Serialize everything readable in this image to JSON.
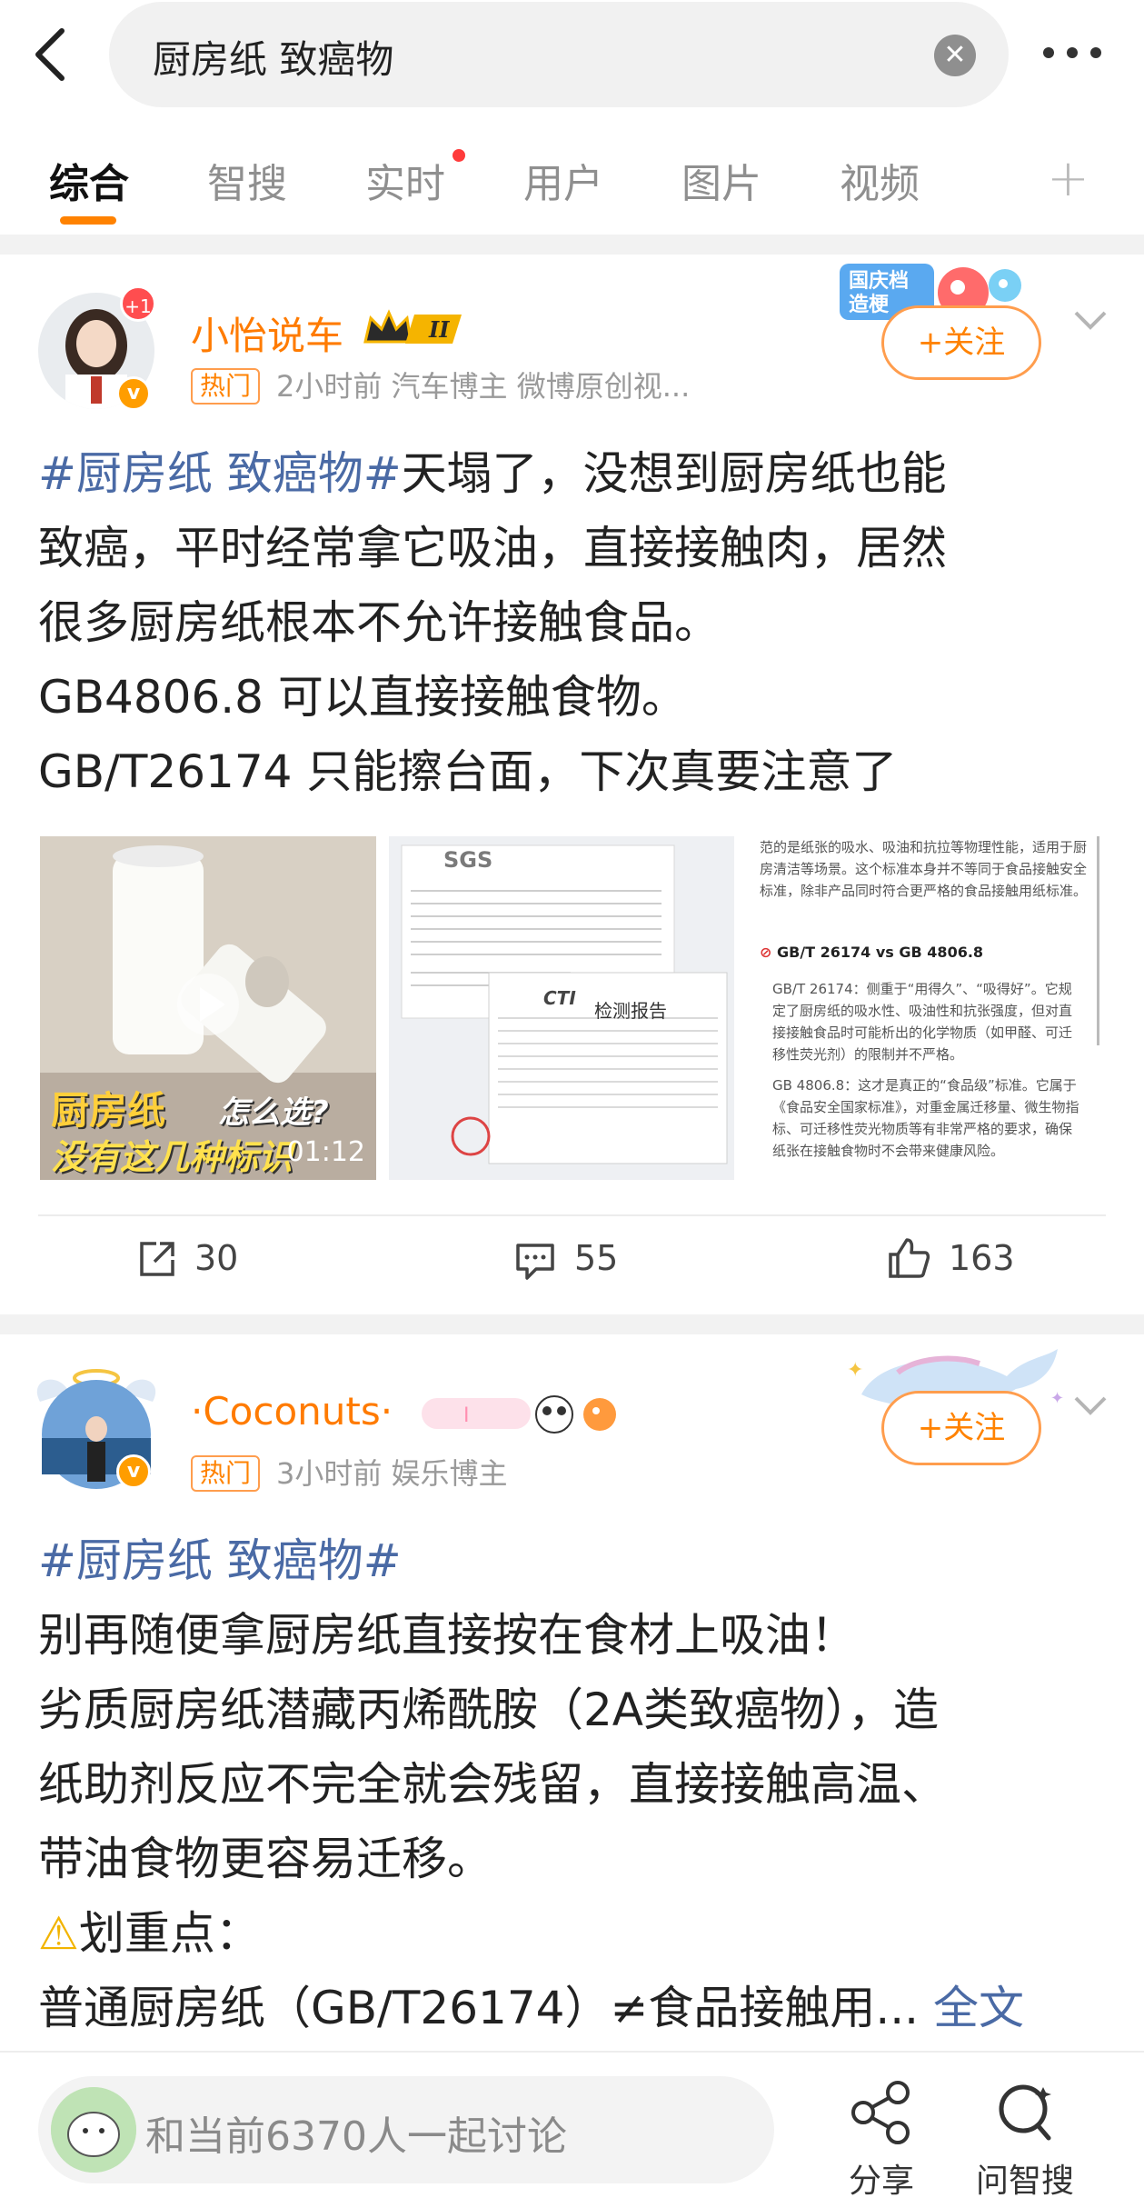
{
  "search": {
    "query": "厨房纸 致癌物"
  },
  "tabs": [
    {
      "label": "综合"
    },
    {
      "label": "智搜"
    },
    {
      "label": "实时"
    },
    {
      "label": "用户"
    },
    {
      "label": "图片"
    },
    {
      "label": "视频"
    }
  ],
  "posts": [
    {
      "author": "小怡说车",
      "plus_badge": "+1",
      "hot_tag": "热门",
      "meta": "2小时前  汽车博主 微博原创视...",
      "follow_label": "+关注",
      "topic": "#厨房纸 致癌物#",
      "lines": [
        "天塌了，没想到厨房纸也能",
        "致癌，平时经常拿它吸油，直接接触肉，居然",
        "很多厨房纸根本不允许接触食品。",
        "GB4806.8 可以直接接触食物。",
        "GB/T26174 只能擦台面，下次真要注意了"
      ],
      "video": {
        "caption1": "厨房纸",
        "caption2": "怎么选?",
        "caption3": "没有这几种标识",
        "duration": "01:12"
      },
      "doc_image": {
        "brand": "SGS",
        "report_title": "检测报告",
        "cti": "CTI"
      },
      "text_image": {
        "intro": "范的是纸张的吸水、吸油和抗拉等物理性能，适用于厨房清洁等场景。这个标准本身并不等同于食品接触安全标准，除非产品同时符合更严格的食品接触用纸标准。",
        "heading": "GB/T 26174 vs GB 4806.8",
        "bullet1": "GB/T 26174：侧重于“用得久”、“吸得好”。它规定了厨房纸的吸水性、吸油性和抗张强度，但对直接接触食品时可能析出的化学物质（如甲醛、可迁移性荧光剂）的限制并不严格。",
        "bullet2": "GB 4806.8：这才是真正的“食品级”标准。它属于《食品安全国家标准》，对重金属迁移量、微生物指标、可迁移性荧光物质等有非常严格的要求，确保纸张在接触食物时不会带来健康风险。"
      },
      "stats": {
        "reposts": "30",
        "comments": "55",
        "likes": "163"
      }
    },
    {
      "author": "·Coconuts·",
      "hot_tag": "热门",
      "meta": "3小时前  娱乐博主",
      "follow_label": "+关注",
      "topic": "#厨房纸 致癌物#",
      "lines": [
        "别再随便拿厨房纸直接按在食材上吸油！",
        "劣质厨房纸潜藏丙烯酰胺（2A类致癌物），造",
        "纸助剂反应不完全就会残留，直接接触高温、",
        "带油食物更容易迁移。",
        "划重点：",
        "普通厨房纸（GB/T26174）≠食品接触用..."
      ],
      "more_label": "全文"
    }
  ],
  "bottom": {
    "discuss": "和当前6370人一起讨论",
    "share": "分享",
    "ask": "问智搜"
  },
  "colors": {
    "accent": "#ff8200",
    "topic": "#4a6aa5",
    "hot_border": "#ff9d4d"
  }
}
